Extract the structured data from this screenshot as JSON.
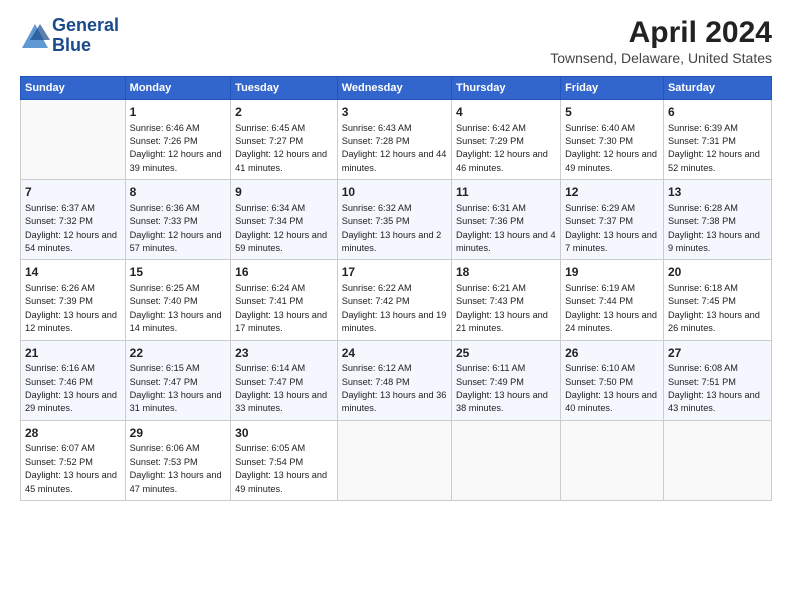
{
  "header": {
    "logo_line1": "General",
    "logo_line2": "Blue",
    "title": "April 2024",
    "subtitle": "Townsend, Delaware, United States"
  },
  "days_of_week": [
    "Sunday",
    "Monday",
    "Tuesday",
    "Wednesday",
    "Thursday",
    "Friday",
    "Saturday"
  ],
  "weeks": [
    [
      {
        "day": "",
        "sunrise": "",
        "sunset": "",
        "daylight": ""
      },
      {
        "day": "1",
        "sunrise": "Sunrise: 6:46 AM",
        "sunset": "Sunset: 7:26 PM",
        "daylight": "Daylight: 12 hours and 39 minutes."
      },
      {
        "day": "2",
        "sunrise": "Sunrise: 6:45 AM",
        "sunset": "Sunset: 7:27 PM",
        "daylight": "Daylight: 12 hours and 41 minutes."
      },
      {
        "day": "3",
        "sunrise": "Sunrise: 6:43 AM",
        "sunset": "Sunset: 7:28 PM",
        "daylight": "Daylight: 12 hours and 44 minutes."
      },
      {
        "day": "4",
        "sunrise": "Sunrise: 6:42 AM",
        "sunset": "Sunset: 7:29 PM",
        "daylight": "Daylight: 12 hours and 46 minutes."
      },
      {
        "day": "5",
        "sunrise": "Sunrise: 6:40 AM",
        "sunset": "Sunset: 7:30 PM",
        "daylight": "Daylight: 12 hours and 49 minutes."
      },
      {
        "day": "6",
        "sunrise": "Sunrise: 6:39 AM",
        "sunset": "Sunset: 7:31 PM",
        "daylight": "Daylight: 12 hours and 52 minutes."
      }
    ],
    [
      {
        "day": "7",
        "sunrise": "Sunrise: 6:37 AM",
        "sunset": "Sunset: 7:32 PM",
        "daylight": "Daylight: 12 hours and 54 minutes."
      },
      {
        "day": "8",
        "sunrise": "Sunrise: 6:36 AM",
        "sunset": "Sunset: 7:33 PM",
        "daylight": "Daylight: 12 hours and 57 minutes."
      },
      {
        "day": "9",
        "sunrise": "Sunrise: 6:34 AM",
        "sunset": "Sunset: 7:34 PM",
        "daylight": "Daylight: 12 hours and 59 minutes."
      },
      {
        "day": "10",
        "sunrise": "Sunrise: 6:32 AM",
        "sunset": "Sunset: 7:35 PM",
        "daylight": "Daylight: 13 hours and 2 minutes."
      },
      {
        "day": "11",
        "sunrise": "Sunrise: 6:31 AM",
        "sunset": "Sunset: 7:36 PM",
        "daylight": "Daylight: 13 hours and 4 minutes."
      },
      {
        "day": "12",
        "sunrise": "Sunrise: 6:29 AM",
        "sunset": "Sunset: 7:37 PM",
        "daylight": "Daylight: 13 hours and 7 minutes."
      },
      {
        "day": "13",
        "sunrise": "Sunrise: 6:28 AM",
        "sunset": "Sunset: 7:38 PM",
        "daylight": "Daylight: 13 hours and 9 minutes."
      }
    ],
    [
      {
        "day": "14",
        "sunrise": "Sunrise: 6:26 AM",
        "sunset": "Sunset: 7:39 PM",
        "daylight": "Daylight: 13 hours and 12 minutes."
      },
      {
        "day": "15",
        "sunrise": "Sunrise: 6:25 AM",
        "sunset": "Sunset: 7:40 PM",
        "daylight": "Daylight: 13 hours and 14 minutes."
      },
      {
        "day": "16",
        "sunrise": "Sunrise: 6:24 AM",
        "sunset": "Sunset: 7:41 PM",
        "daylight": "Daylight: 13 hours and 17 minutes."
      },
      {
        "day": "17",
        "sunrise": "Sunrise: 6:22 AM",
        "sunset": "Sunset: 7:42 PM",
        "daylight": "Daylight: 13 hours and 19 minutes."
      },
      {
        "day": "18",
        "sunrise": "Sunrise: 6:21 AM",
        "sunset": "Sunset: 7:43 PM",
        "daylight": "Daylight: 13 hours and 21 minutes."
      },
      {
        "day": "19",
        "sunrise": "Sunrise: 6:19 AM",
        "sunset": "Sunset: 7:44 PM",
        "daylight": "Daylight: 13 hours and 24 minutes."
      },
      {
        "day": "20",
        "sunrise": "Sunrise: 6:18 AM",
        "sunset": "Sunset: 7:45 PM",
        "daylight": "Daylight: 13 hours and 26 minutes."
      }
    ],
    [
      {
        "day": "21",
        "sunrise": "Sunrise: 6:16 AM",
        "sunset": "Sunset: 7:46 PM",
        "daylight": "Daylight: 13 hours and 29 minutes."
      },
      {
        "day": "22",
        "sunrise": "Sunrise: 6:15 AM",
        "sunset": "Sunset: 7:47 PM",
        "daylight": "Daylight: 13 hours and 31 minutes."
      },
      {
        "day": "23",
        "sunrise": "Sunrise: 6:14 AM",
        "sunset": "Sunset: 7:47 PM",
        "daylight": "Daylight: 13 hours and 33 minutes."
      },
      {
        "day": "24",
        "sunrise": "Sunrise: 6:12 AM",
        "sunset": "Sunset: 7:48 PM",
        "daylight": "Daylight: 13 hours and 36 minutes."
      },
      {
        "day": "25",
        "sunrise": "Sunrise: 6:11 AM",
        "sunset": "Sunset: 7:49 PM",
        "daylight": "Daylight: 13 hours and 38 minutes."
      },
      {
        "day": "26",
        "sunrise": "Sunrise: 6:10 AM",
        "sunset": "Sunset: 7:50 PM",
        "daylight": "Daylight: 13 hours and 40 minutes."
      },
      {
        "day": "27",
        "sunrise": "Sunrise: 6:08 AM",
        "sunset": "Sunset: 7:51 PM",
        "daylight": "Daylight: 13 hours and 43 minutes."
      }
    ],
    [
      {
        "day": "28",
        "sunrise": "Sunrise: 6:07 AM",
        "sunset": "Sunset: 7:52 PM",
        "daylight": "Daylight: 13 hours and 45 minutes."
      },
      {
        "day": "29",
        "sunrise": "Sunrise: 6:06 AM",
        "sunset": "Sunset: 7:53 PM",
        "daylight": "Daylight: 13 hours and 47 minutes."
      },
      {
        "day": "30",
        "sunrise": "Sunrise: 6:05 AM",
        "sunset": "Sunset: 7:54 PM",
        "daylight": "Daylight: 13 hours and 49 minutes."
      },
      {
        "day": "",
        "sunrise": "",
        "sunset": "",
        "daylight": ""
      },
      {
        "day": "",
        "sunrise": "",
        "sunset": "",
        "daylight": ""
      },
      {
        "day": "",
        "sunrise": "",
        "sunset": "",
        "daylight": ""
      },
      {
        "day": "",
        "sunrise": "",
        "sunset": "",
        "daylight": ""
      }
    ]
  ]
}
